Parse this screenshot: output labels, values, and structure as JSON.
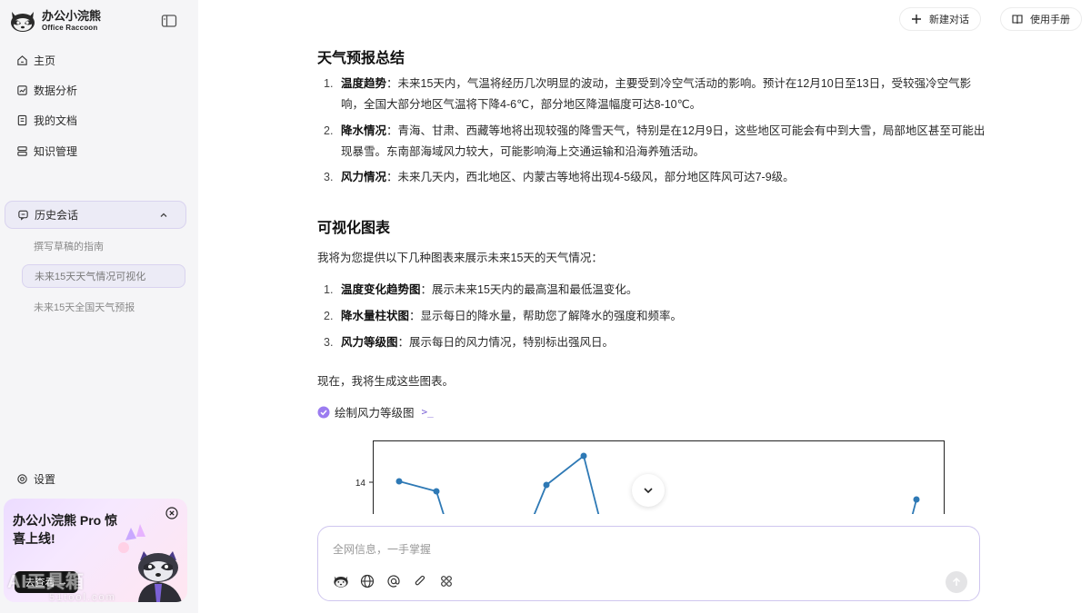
{
  "sidebar": {
    "brand_name": "办公小浣熊",
    "brand_sub": "Office Raccoon",
    "nav": [
      "主页",
      "数据分析",
      "我的文档",
      "知识管理"
    ],
    "history_label": "历史会话",
    "history_items": [
      "撰写草稿的指南",
      "未来15天天气情况可视化",
      "未来15天全国天气预报"
    ],
    "settings_label": "设置",
    "promo_title": "办公小浣熊 Pro 惊喜上线!",
    "promo_button": "去查看",
    "watermark": "AI工具箱",
    "watermark_sub": "51tool.com"
  },
  "topbar": {
    "new_chat": "新建对话",
    "manual": "使用手册"
  },
  "content": {
    "section1_title": "天气预报总结",
    "section1_items": [
      {
        "bold": "温度趋势",
        "text": "：未来15天内，气温将经历几次明显的波动，主要受到冷空气活动的影响。预计在12月10日至13日，受较强冷空气影响，全国大部分地区气温将下降4-6℃，部分地区降温幅度可达8-10℃。"
      },
      {
        "bold": "降水情况",
        "text": "：青海、甘肃、西藏等地将出现较强的降雪天气，特别是在12月9日，这些地区可能会有中到大雪，局部地区甚至可能出现暴雪。东南部海域风力较大，可能影响海上交通运输和沿海养殖活动。"
      },
      {
        "bold": "风力情况",
        "text": "：未来几天内，西北地区、内蒙古等地将出现4-5级风，部分地区阵风可达7-9级。"
      }
    ],
    "section2_title": "可视化图表",
    "section2_intro": "我将为您提供以下几种图表来展示未来15天的天气情况：",
    "section2_items": [
      {
        "bold": "温度变化趋势图",
        "text": "：展示未来15天内的最高温和最低温变化。"
      },
      {
        "bold": "降水量柱状图",
        "text": "：显示每日的降水量，帮助您了解降水的强度和频率。"
      },
      {
        "bold": "风力等级图",
        "text": "：展示每日的风力情况，特别标出强风日。"
      }
    ],
    "closing": "现在，我将生成这些图表。",
    "tool_label": "绘制风力等级图",
    "tool_caret": ">_"
  },
  "chart_data": {
    "type": "line",
    "y_tick_label": "14",
    "series_color": "#2e79b5"
  },
  "composer": {
    "placeholder": "全网信息，一手掌握"
  }
}
